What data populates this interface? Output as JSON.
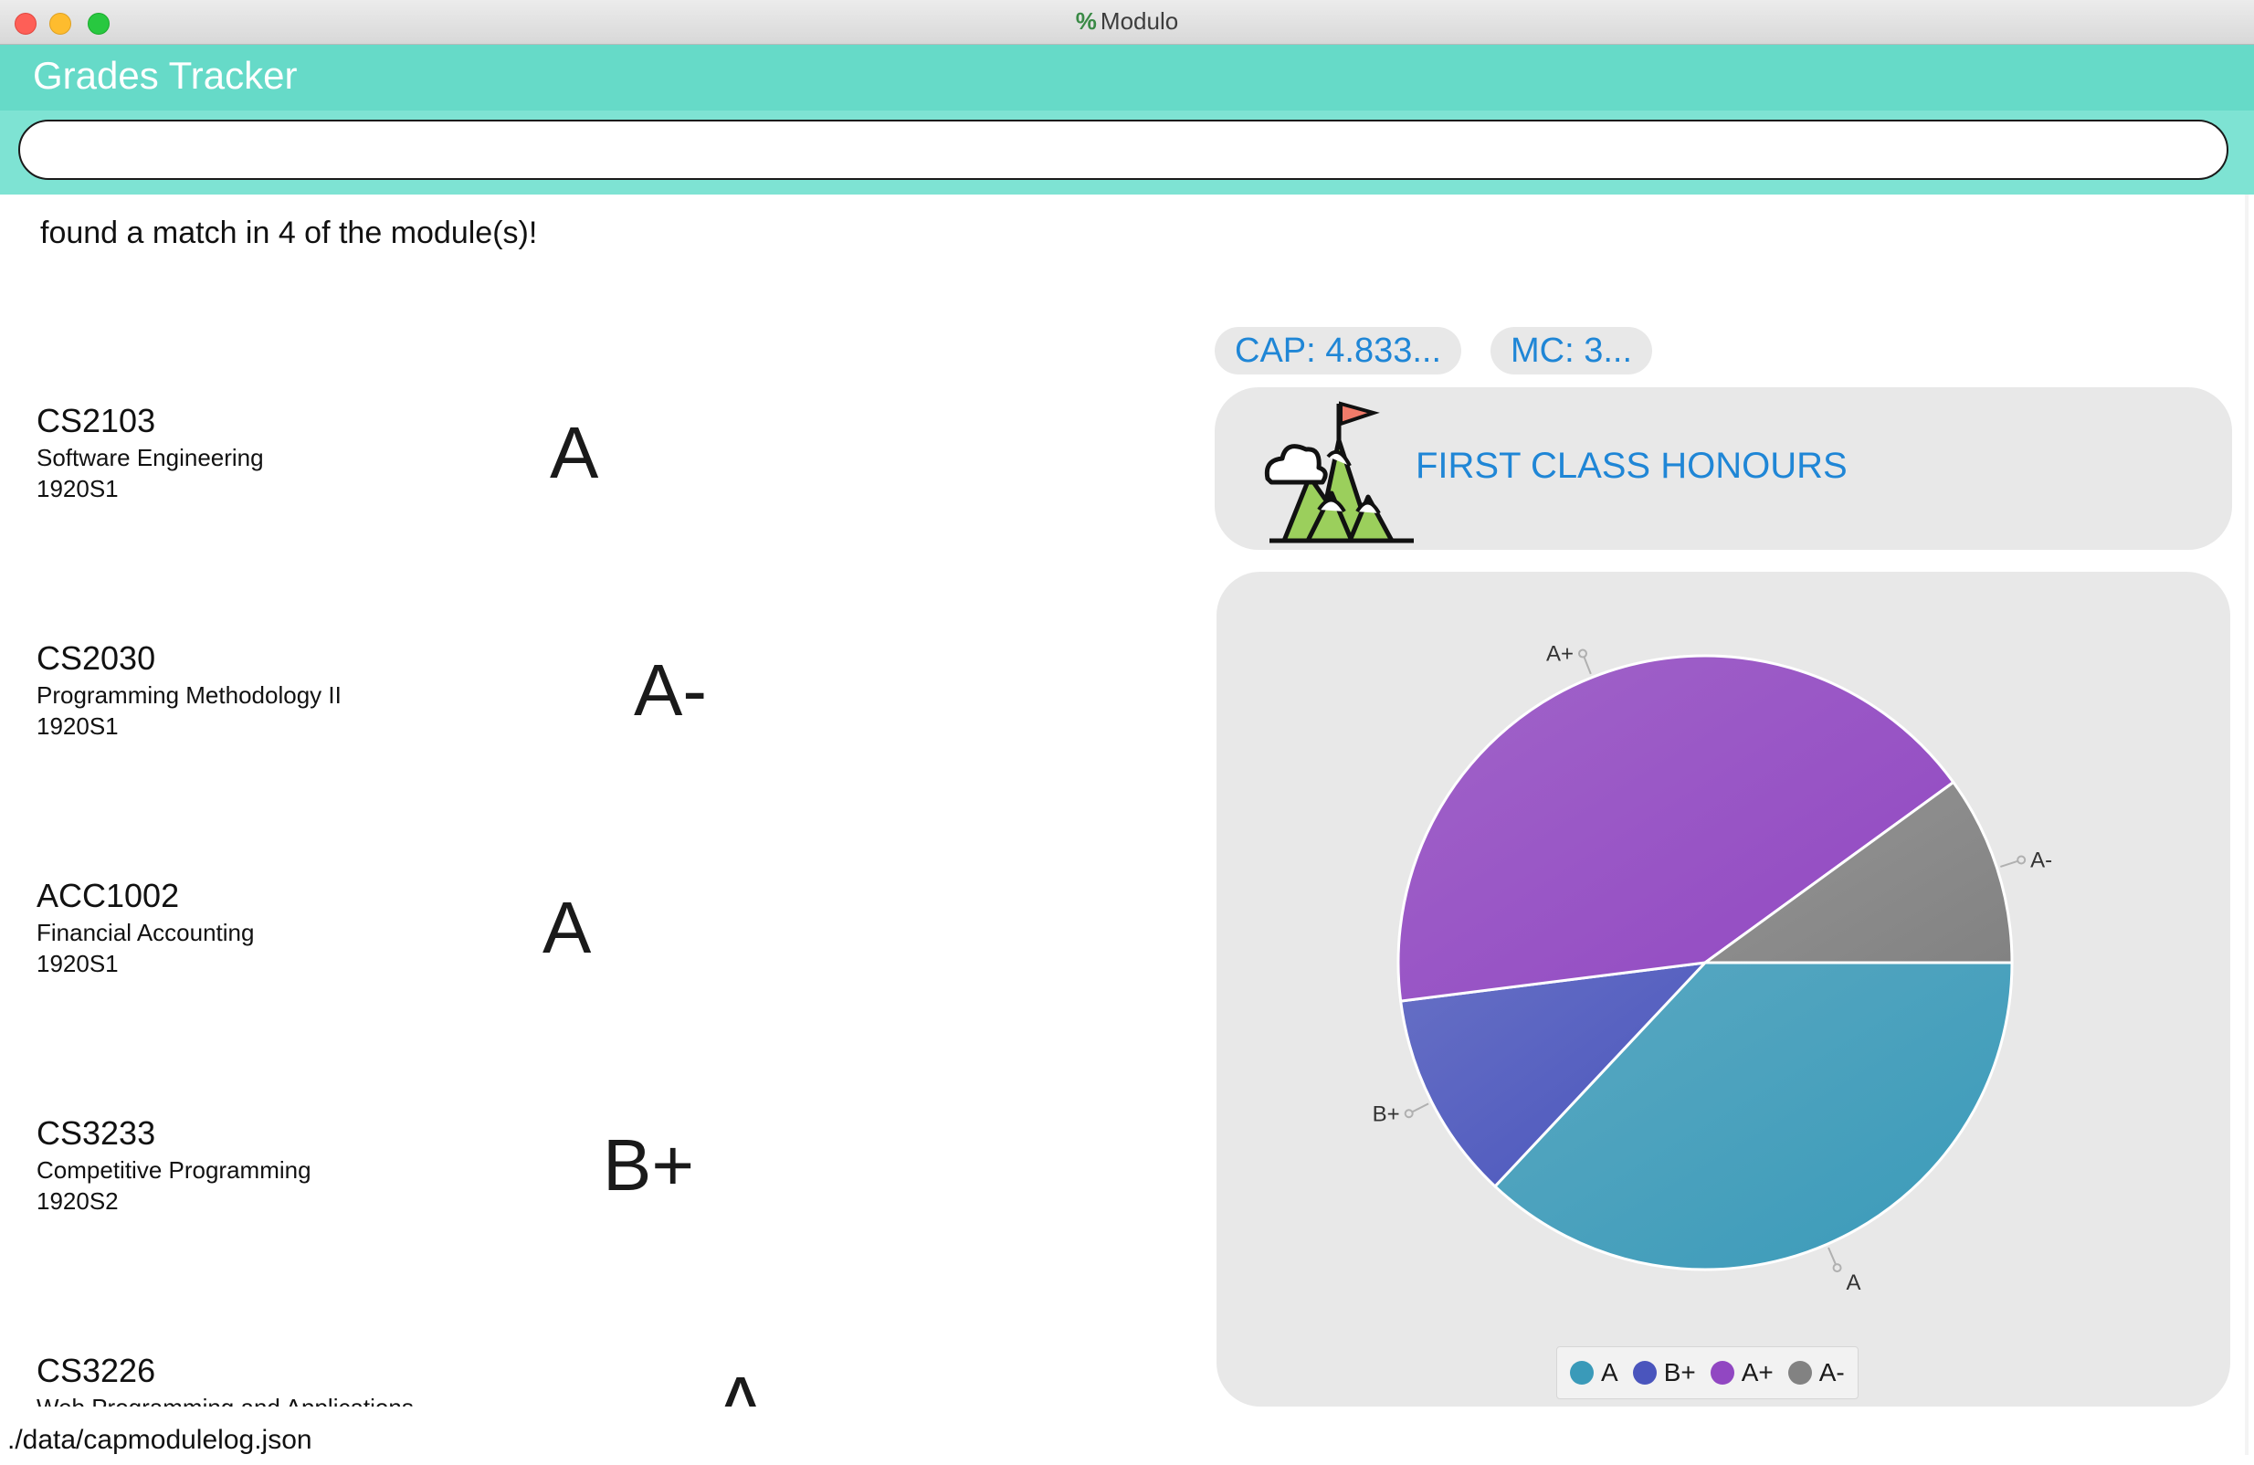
{
  "window": {
    "title": "Modulo",
    "title_icon": "%"
  },
  "header": {
    "title": "Grades Tracker"
  },
  "command": {
    "value": "",
    "placeholder": ""
  },
  "feedback": "found a match in 4 of the module(s)!",
  "modules": [
    {
      "code": "CS2103",
      "name": "Software Engineering",
      "semester": "1920S1",
      "grade": "A"
    },
    {
      "code": "CS2030",
      "name": "Programming Methodology II",
      "semester": "1920S1",
      "grade": "A-"
    },
    {
      "code": "ACC1002",
      "name": "Financial Accounting",
      "semester": "1920S1",
      "grade": "A"
    },
    {
      "code": "CS3233",
      "name": "Competitive Programming",
      "semester": "1920S2",
      "grade": "B+"
    },
    {
      "code": "CS3226",
      "name": "Web Programming and Applications",
      "semester": "",
      "grade": "A"
    }
  ],
  "stats": {
    "cap": "CAP: 4.833...",
    "mc": "MC: 3..."
  },
  "honours": {
    "label": "FIRST CLASS HONOURS",
    "icon": "mountain-flag-icon"
  },
  "status_bar": {
    "path": "./data/capmodulelog.json"
  },
  "chart_data": {
    "type": "pie",
    "slices": [
      {
        "label": "A",
        "value": 37,
        "color": "#3a9ab9"
      },
      {
        "label": "B+",
        "value": 11,
        "color": "#4a55bd"
      },
      {
        "label": "A+",
        "value": 42,
        "color": "#9147c2"
      },
      {
        "label": "A-",
        "value": 10,
        "color": "#828282"
      }
    ],
    "legend": [
      "A",
      "B+",
      "A+",
      "A-"
    ],
    "legend_placement": "bottom"
  }
}
